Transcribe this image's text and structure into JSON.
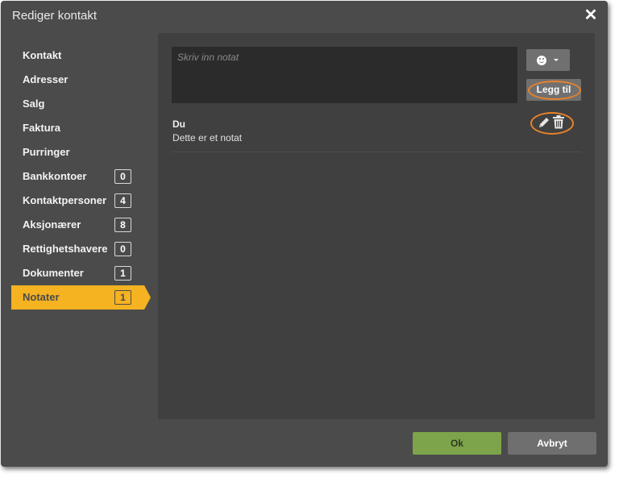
{
  "dialog": {
    "title": "Rediger kontakt",
    "close_glyph": "✕"
  },
  "sidebar": {
    "items": [
      {
        "label": "Kontakt",
        "badge": null,
        "active": false
      },
      {
        "label": "Adresser",
        "badge": null,
        "active": false
      },
      {
        "label": "Salg",
        "badge": null,
        "active": false
      },
      {
        "label": "Faktura",
        "badge": null,
        "active": false
      },
      {
        "label": "Purringer",
        "badge": null,
        "active": false
      },
      {
        "label": "Bankkontoer",
        "badge": "0",
        "active": false
      },
      {
        "label": "Kontaktpersoner",
        "badge": "4",
        "active": false
      },
      {
        "label": "Aksjonærer",
        "badge": "8",
        "active": false
      },
      {
        "label": "Rettighetshavere",
        "badge": "0",
        "active": false
      },
      {
        "label": "Dokumenter",
        "badge": "1",
        "active": false
      },
      {
        "label": "Notater",
        "badge": "1",
        "active": true
      }
    ]
  },
  "notes": {
    "input": {
      "placeholder": "Skriv inn notat",
      "value": ""
    },
    "emoji_button": {
      "icon": "smiley-icon",
      "caret": "chevron-down-icon"
    },
    "add_button_label": "Legg til",
    "list": [
      {
        "author": "Du",
        "text": "Dette er et notat",
        "actions": [
          "pencil-icon",
          "trash-icon"
        ]
      }
    ]
  },
  "footer": {
    "ok_label": "Ok",
    "cancel_label": "Avbryt"
  },
  "colors": {
    "dialog_bg": "#4b4b4b",
    "panel_bg": "#404040",
    "active_tab": "#f5b221",
    "ok_button": "#7da44a",
    "highlight": "#e8832b"
  }
}
